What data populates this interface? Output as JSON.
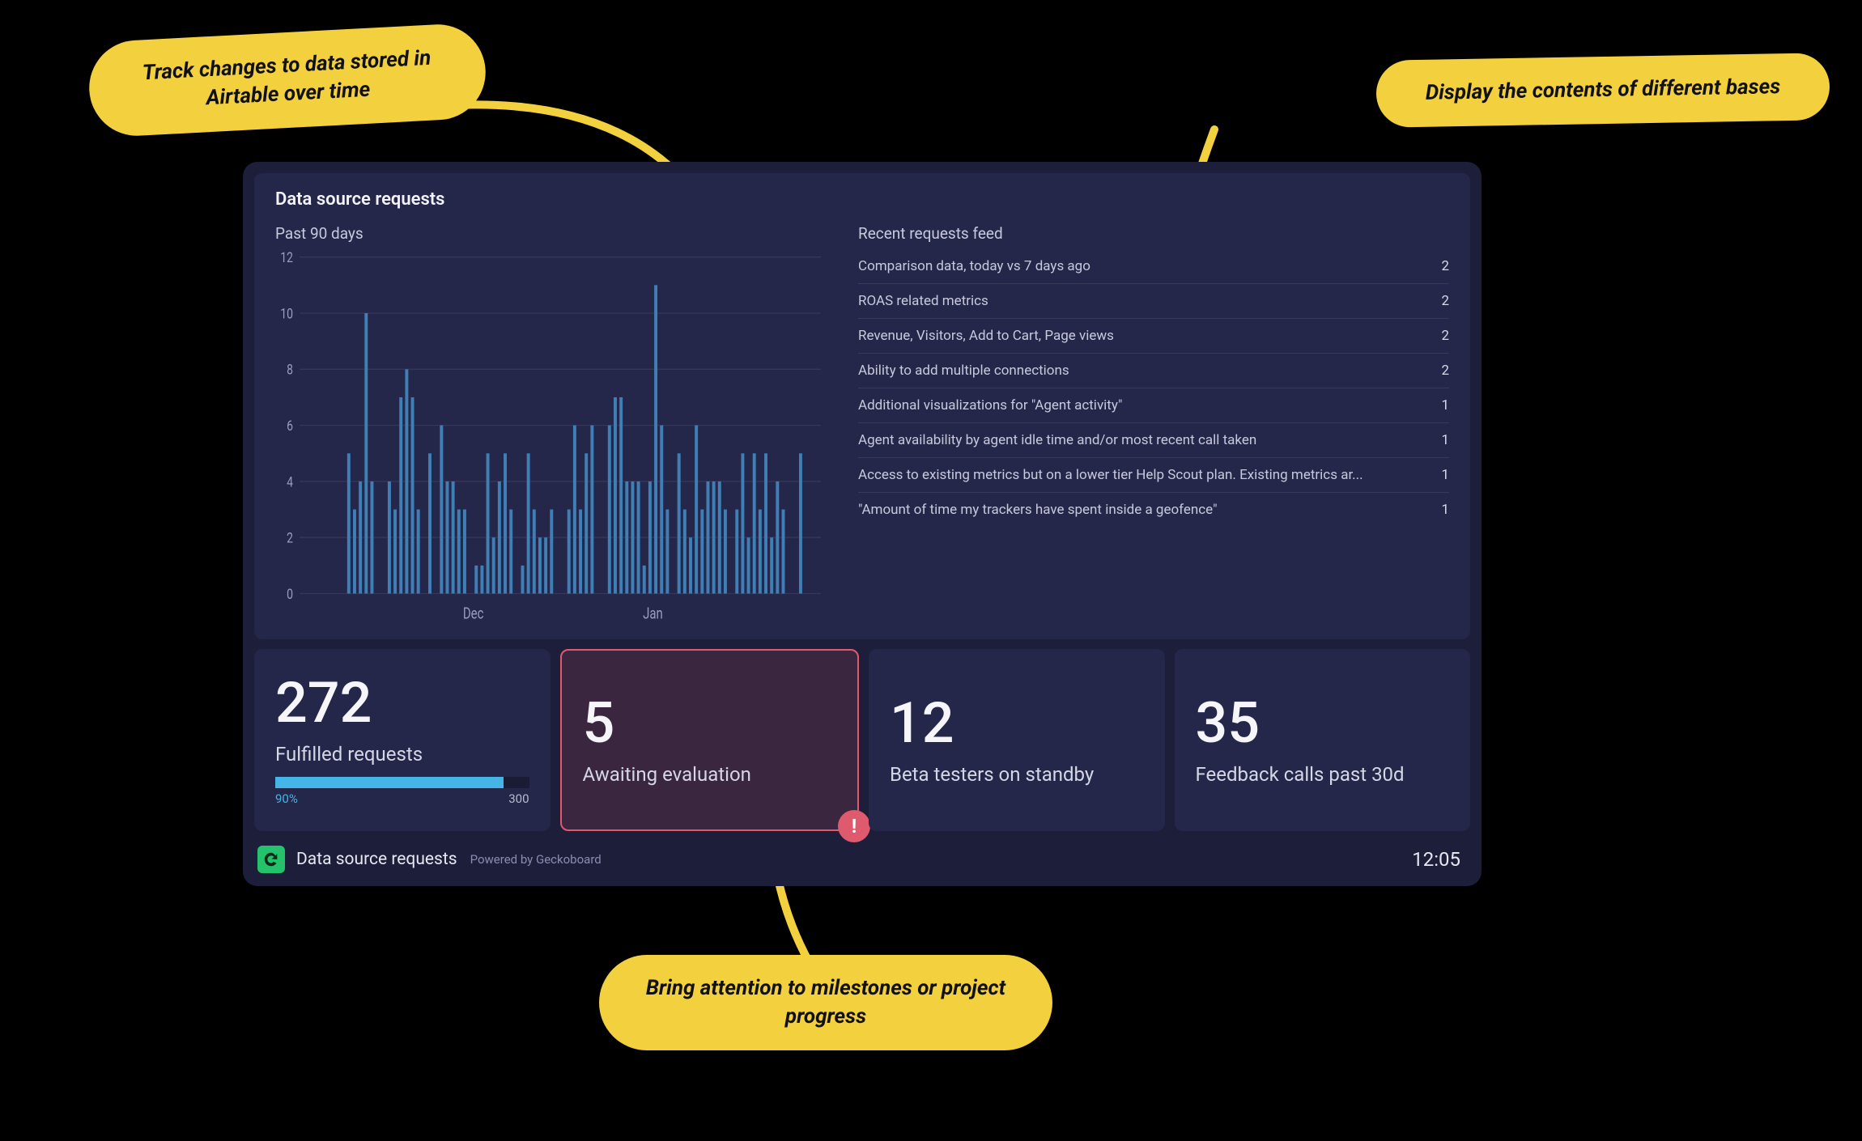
{
  "annotations": {
    "top_left": "Track changes to data stored in Airtable over time",
    "top_right": "Display the contents of different bases",
    "bottom": "Bring attention to milestones or project progress"
  },
  "dashboard": {
    "title": "Data source requests",
    "chart_subtitle": "Past 90 days",
    "feed_subtitle": "Recent requests feed"
  },
  "feed": [
    {
      "label": "Comparison data, today vs 7 days ago",
      "count": 2
    },
    {
      "label": "ROAS related metrics",
      "count": 2
    },
    {
      "label": "Revenue, Visitors, Add to Cart, Page views",
      "count": 2
    },
    {
      "label": "Ability to add multiple connections",
      "count": 2
    },
    {
      "label": "Additional visualizations for \"Agent activity\"",
      "count": 1
    },
    {
      "label": "Agent availability by agent idle time and/or most recent call taken",
      "count": 1
    },
    {
      "label": "Access to existing metrics but on a lower tier Help Scout plan. Existing metrics ar...",
      "count": 1
    },
    {
      "label": "\"Amount of time my trackers have spent inside a geofence\"",
      "count": 1
    }
  ],
  "kpis": [
    {
      "value": "272",
      "label": "Fulfilled requests",
      "progress": {
        "pct_label": "90%",
        "pct": 90,
        "target": "300"
      }
    },
    {
      "value": "5",
      "label": "Awaiting evaluation",
      "alert": true
    },
    {
      "value": "12",
      "label": "Beta testers on standby"
    },
    {
      "value": "35",
      "label": "Feedback calls past 30d"
    }
  ],
  "footer": {
    "dashboard_name": "Data source requests",
    "powered_by": "Powered by Geckoboard",
    "clock": "12:05"
  },
  "chart_data": {
    "type": "bar",
    "title": "Data source requests — Past 90 days",
    "xlabel": "",
    "ylabel": "",
    "ylim": [
      0,
      12
    ],
    "y_ticks": [
      0,
      2,
      4,
      6,
      8,
      10,
      12
    ],
    "x_tick_labels": [
      "Dec",
      "Jan"
    ],
    "x_tick_positions": [
      30,
      61
    ],
    "categories_count": 90,
    "values": [
      0,
      0,
      0,
      0,
      0,
      0,
      0,
      0,
      5,
      3,
      4,
      10,
      4,
      0,
      0,
      4,
      3,
      7,
      8,
      7,
      3,
      0,
      5,
      0,
      6,
      4,
      4,
      3,
      3,
      0,
      1,
      1,
      5,
      2,
      4,
      5,
      3,
      0,
      1,
      5,
      3,
      2,
      2,
      3,
      0,
      0,
      3,
      6,
      3,
      5,
      6,
      0,
      0,
      6,
      7,
      7,
      4,
      4,
      4,
      1,
      4,
      11,
      6,
      3,
      0,
      5,
      3,
      2,
      6,
      3,
      4,
      4,
      4,
      3,
      0,
      3,
      5,
      2,
      5,
      3,
      5,
      2,
      4,
      3,
      0,
      0,
      5,
      0,
      0,
      0
    ]
  },
  "colors": {
    "card_bg": "#25274a",
    "dash_bg": "#1c1e3a",
    "accent_blue": "#45b4e6",
    "chart_bar": "#3f7fb5",
    "alert_red": "#e05a6d",
    "callout_yellow": "#f3d03e",
    "logo_green": "#23c26b"
  }
}
